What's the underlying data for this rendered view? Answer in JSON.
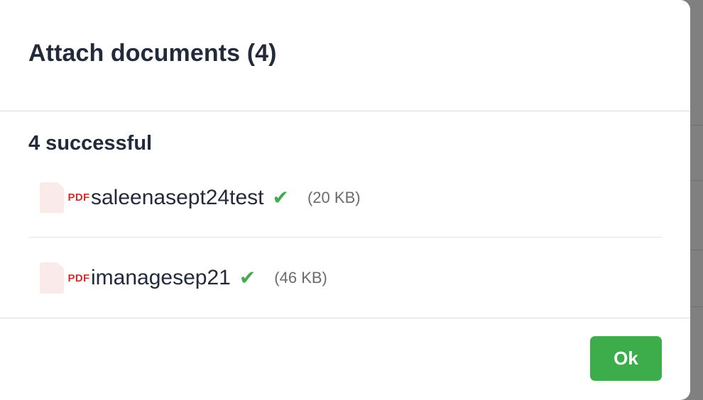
{
  "dialog": {
    "title": "Attach documents (4)",
    "section_title": "4 successful",
    "files": [
      {
        "icon": "pdf-file-icon",
        "type_label": "PDF",
        "name": "saleenasept24test",
        "status_icon": "check-icon",
        "size": "(20 KB)"
      },
      {
        "icon": "pdf-file-icon",
        "type_label": "PDF",
        "name": "imanagesep21",
        "status_icon": "check-icon",
        "size": "(46 KB)"
      }
    ],
    "ok_label": "Ok"
  },
  "colors": {
    "accent": "#3cad4a",
    "check": "#46a94a",
    "pdf_label": "#d0312d",
    "title_text": "#232b3a"
  }
}
